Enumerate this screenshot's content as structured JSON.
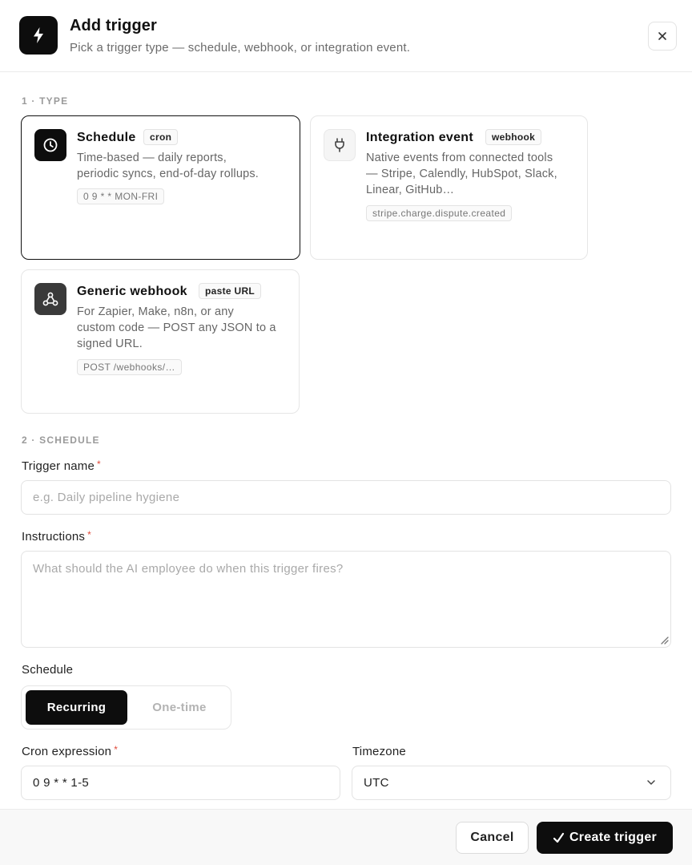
{
  "header": {
    "title": "Add trigger",
    "subtitle": "Pick a trigger type — schedule, webhook, or integration event.",
    "icon": "lightning-icon",
    "close_icon": "close-icon"
  },
  "type_section": {
    "label": "1 · TYPE",
    "cards": [
      {
        "title": "Schedule",
        "badge": "cron",
        "desc_lines": [
          "Time-based — daily reports,",
          "periodic syncs, end-of-day rollups."
        ],
        "code": "0 9 * * MON-FRI",
        "icon": "clock-icon",
        "selected": true
      },
      {
        "title": "Integration event",
        "badge": "webhook",
        "desc_lines": [
          "Native events from connected tools",
          "— Stripe, Calendly, HubSpot, Slack,",
          "Linear, GitHub…"
        ],
        "code": "stripe.charge.dispute.created",
        "icon": "plug-icon",
        "selected": false
      },
      {
        "title": "Generic webhook",
        "badge": "paste URL",
        "desc_lines": [
          "For Zapier, Make, n8n, or any",
          "custom code — POST any JSON to a",
          "signed URL."
        ],
        "code": "POST /webhooks/…",
        "icon": "webhook-icon",
        "selected": false
      }
    ]
  },
  "schedule_section": {
    "label": "2 · SCHEDULE",
    "trigger_name": {
      "label": "Trigger name",
      "required_mark": "*",
      "placeholder": "e.g. Daily pipeline hygiene",
      "value": ""
    },
    "instructions": {
      "label": "Instructions",
      "required_mark": "*",
      "placeholder": "What should the AI employee do when this trigger fires?",
      "value": ""
    },
    "schedule": {
      "label": "Schedule",
      "options": [
        "Recurring",
        "One-time"
      ],
      "selected": "Recurring"
    },
    "cron": {
      "label": "Cron expression",
      "required_mark": "*",
      "value": "0 9 * * 1-5"
    },
    "timezone": {
      "label": "Timezone",
      "value": "UTC",
      "icon": "chevron-down-icon"
    }
  },
  "footer": {
    "cancel_label": "Cancel",
    "create_label": "Create trigger",
    "create_icon": "checkmark-icon"
  },
  "colors": {
    "primary": "#0d0d0d",
    "required": "#e04a3a",
    "border": "#e3e3e3",
    "muted_text": "#6b6b6b"
  }
}
